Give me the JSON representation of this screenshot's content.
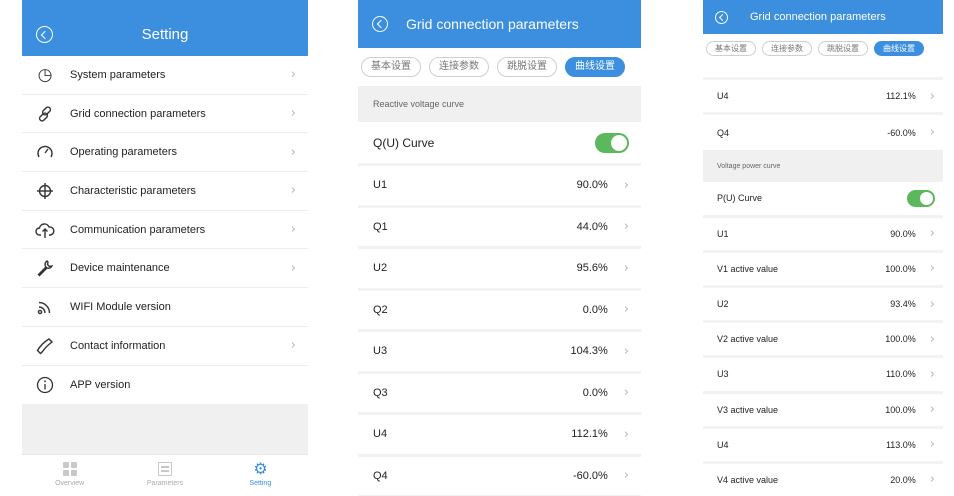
{
  "setting_screen": {
    "title": "Setting",
    "menu": [
      {
        "label": "System parameters",
        "icon": "clock-icon",
        "chevron": true
      },
      {
        "label": "Grid connection parameters",
        "icon": "link-icon",
        "chevron": true
      },
      {
        "label": "Operating parameters",
        "icon": "speedometer-icon",
        "chevron": true
      },
      {
        "label": "Characteristic parameters",
        "icon": "crosshair-icon",
        "chevron": true
      },
      {
        "label": "Communication parameters",
        "icon": "cloud-upload-icon",
        "chevron": true
      },
      {
        "label": "Device maintenance",
        "icon": "wrench-icon",
        "chevron": true
      },
      {
        "label": "WIFI Module version",
        "icon": "wifi-icon",
        "chevron": false
      },
      {
        "label": "Contact information",
        "icon": "phone-icon",
        "chevron": true
      },
      {
        "label": "APP version",
        "icon": "info-icon",
        "chevron": false
      }
    ],
    "tabs": [
      {
        "label": "Overview",
        "icon": "grid-icon",
        "active": false
      },
      {
        "label": "Parameters",
        "icon": "document-icon",
        "active": false
      },
      {
        "label": "Setting",
        "icon": "gear-icon",
        "active": true
      }
    ]
  },
  "grid_screen_1": {
    "title": "Grid connection parameters",
    "segments": [
      "基本设置",
      "连接参数",
      "跳脱设置",
      "曲线设置"
    ],
    "active_segment": "曲线设置",
    "section": "Reactive voltage curve",
    "toggle": {
      "label": "Q(U) Curve",
      "on": true
    },
    "rows": [
      {
        "label": "U1",
        "value": "90.0%"
      },
      {
        "label": "Q1",
        "value": "44.0%"
      },
      {
        "label": "U2",
        "value": "95.6%"
      },
      {
        "label": "Q2",
        "value": "0.0%"
      },
      {
        "label": "U3",
        "value": "104.3%"
      },
      {
        "label": "Q3",
        "value": "0.0%"
      },
      {
        "label": "U4",
        "value": "112.1%"
      },
      {
        "label": "Q4",
        "value": "-60.0%"
      }
    ]
  },
  "grid_screen_2": {
    "title": "Grid connection parameters",
    "segments": [
      "基本设置",
      "连接参数",
      "跳脱设置",
      "曲线设置"
    ],
    "active_segment": "曲线设置",
    "top_rows": [
      {
        "label": "U4",
        "value": "112.1%"
      },
      {
        "label": "Q4",
        "value": "-60.0%"
      }
    ],
    "section": "Voltage power curve",
    "toggle": {
      "label": "P(U) Curve",
      "on": true
    },
    "rows": [
      {
        "label": "U1",
        "value": "90.0%"
      },
      {
        "label": "V1 active value",
        "value": "100.0%"
      },
      {
        "label": "U2",
        "value": "93.4%"
      },
      {
        "label": "V2 active value",
        "value": "100.0%"
      },
      {
        "label": "U3",
        "value": "110.0%"
      },
      {
        "label": "V3 active value",
        "value": "100.0%"
      },
      {
        "label": "U4",
        "value": "113.0%"
      },
      {
        "label": "V4 active value",
        "value": "20.0%"
      }
    ]
  },
  "colors": {
    "accent": "#3b8fde",
    "toggle_on": "#5cb85c",
    "section_bg": "#f0f0f0"
  }
}
